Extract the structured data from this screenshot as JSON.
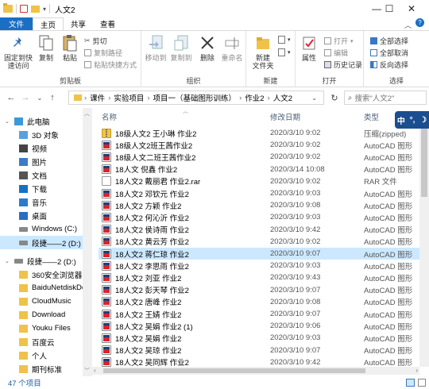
{
  "window": {
    "title": "人文2",
    "minimize_glyph": "—",
    "maximize_glyph": "☐",
    "close_glyph": "✕"
  },
  "tabs": [
    "文件",
    "主页",
    "共享",
    "查看"
  ],
  "ribbon": {
    "clipboard": {
      "label": "剪贴板",
      "pin": "固定到快\n速访问",
      "copy": "复制",
      "paste": "粘贴",
      "cut": "剪切",
      "copy_path": "复制路径",
      "paste_shortcut": "粘贴快捷方式"
    },
    "organize": {
      "label": "组织",
      "move_to": "移动到",
      "copy_to": "复制到",
      "delete": "删除",
      "rename": "重命名"
    },
    "new": {
      "label": "新建",
      "new_folder": "新建\n文件夹"
    },
    "open": {
      "label": "打开",
      "properties": "属性",
      "open": "打开",
      "edit": "编辑",
      "history": "历史记录"
    },
    "select": {
      "label": "选择",
      "select_all": "全部选择",
      "select_none": "全部取消",
      "invert": "反向选择"
    }
  },
  "address": {
    "breadcrumb": [
      "课件",
      "实验项目",
      "项目一（基础图形训练）",
      "作业2",
      "人文2"
    ],
    "search_placeholder": "搜索\"人文2\""
  },
  "nav": {
    "items": [
      {
        "label": "此电脑",
        "icon": "pc-icon"
      },
      {
        "label": "3D 对象",
        "icon": "cube-icon"
      },
      {
        "label": "视频",
        "icon": "video-icon"
      },
      {
        "label": "图片",
        "icon": "picture-icon"
      },
      {
        "label": "文档",
        "icon": "document-icon"
      },
      {
        "label": "下载",
        "icon": "download-icon"
      },
      {
        "label": "音乐",
        "icon": "music-icon"
      },
      {
        "label": "桌面",
        "icon": "desktop-icon"
      },
      {
        "label": "Windows (C:)",
        "icon": "drive-icon"
      },
      {
        "label": "段捷——2 (D:)",
        "icon": "drive-icon"
      },
      {
        "label": "段捷——2 (D:)",
        "icon": "drive-icon"
      },
      {
        "label": "360安全浏览器下",
        "icon": "folder-icon"
      },
      {
        "label": "BaiduNetdiskDo",
        "icon": "folder-icon"
      },
      {
        "label": "CloudMusic",
        "icon": "folder-icon"
      },
      {
        "label": "Download",
        "icon": "folder-icon"
      },
      {
        "label": "Youku Files",
        "icon": "folder-icon"
      },
      {
        "label": "百度云",
        "icon": "folder-icon"
      },
      {
        "label": "个人",
        "icon": "folder-icon"
      },
      {
        "label": "期刊标准",
        "icon": "folder-icon"
      }
    ]
  },
  "columns": {
    "name": "名称",
    "date": "修改日期",
    "type": "类型"
  },
  "files": [
    {
      "name": "18级人文2 王小琳 作业2",
      "date": "2020/3/10 9:02",
      "type": "压缩(zipped)",
      "icon": "zip"
    },
    {
      "name": "18级人文2班王茜作业2",
      "date": "2020/3/10 9:02",
      "type": "AutoCAD 图形",
      "icon": "cad"
    },
    {
      "name": "18级人文二班王茜作业2",
      "date": "2020/3/10 9:02",
      "type": "AutoCAD 图形",
      "icon": "cad"
    },
    {
      "name": "18人文 倪鑫 作业2",
      "date": "2020/3/14 10:08",
      "type": "AutoCAD 图形",
      "icon": "cad"
    },
    {
      "name": "18人文2 戴丽君 作业2.rar",
      "date": "2020/3/10 9:02",
      "type": "RAR 文件",
      "icon": "rar"
    },
    {
      "name": "18人文2 邓钦元 作业2",
      "date": "2020/3/10 9:03",
      "type": "AutoCAD 图形",
      "icon": "cad"
    },
    {
      "name": "18人文2 方颖 作业2",
      "date": "2020/3/10 9:08",
      "type": "AutoCAD 图形",
      "icon": "cad"
    },
    {
      "name": "18人文2 何沁沂 作业2",
      "date": "2020/3/10 9:03",
      "type": "AutoCAD 图形",
      "icon": "cad"
    },
    {
      "name": "18人文2 侯诗雨 作业2",
      "date": "2020/3/10 9:42",
      "type": "AutoCAD 图形",
      "icon": "cad"
    },
    {
      "name": "18人文2 黄云芳 作业2",
      "date": "2020/3/10 9:02",
      "type": "AutoCAD 图形",
      "icon": "cad"
    },
    {
      "name": "18人文2 蒋仁琼 作业2",
      "date": "2020/3/10 9:07",
      "type": "AutoCAD 图形",
      "icon": "cad",
      "selected": true
    },
    {
      "name": "18人文2 李思雨 作业2",
      "date": "2020/3/10 9:03",
      "type": "AutoCAD 图形",
      "icon": "cad"
    },
    {
      "name": "18人文2 刘亚 作业2",
      "date": "2020/3/10 9:43",
      "type": "AutoCAD 图形",
      "icon": "cad"
    },
    {
      "name": "18人文2 彭天琴 作业2",
      "date": "2020/3/10 9:07",
      "type": "AutoCAD 图形",
      "icon": "cad"
    },
    {
      "name": "18人文2 唐峰 作业2",
      "date": "2020/3/10 9:08",
      "type": "AutoCAD 图形",
      "icon": "cad"
    },
    {
      "name": "18人文2 王婧 作业2",
      "date": "2020/3/10 9:07",
      "type": "AutoCAD 图形",
      "icon": "cad"
    },
    {
      "name": "18人文2 吴娟 作业2 (1)",
      "date": "2020/3/10 9:06",
      "type": "AutoCAD 图形",
      "icon": "cad"
    },
    {
      "name": "18人文2 吴娟 作业2",
      "date": "2020/3/10 9:03",
      "type": "AutoCAD 图形",
      "icon": "cad"
    },
    {
      "name": "18人文2 吴琼 作业2",
      "date": "2020/3/10 9:07",
      "type": "AutoCAD 图形",
      "icon": "cad"
    },
    {
      "name": "18人文2 吴同辉 作业2",
      "date": "2020/3/10 9:42",
      "type": "AutoCAD 图形",
      "icon": "cad"
    }
  ],
  "status": {
    "count": "47 个项目"
  },
  "ime": {
    "lang": "中",
    "punct": "°,",
    "moon": "☽"
  },
  "colors": {
    "accent": "#1a6fc4",
    "selection": "#cce8ff",
    "ime": "#1b4e8f"
  }
}
